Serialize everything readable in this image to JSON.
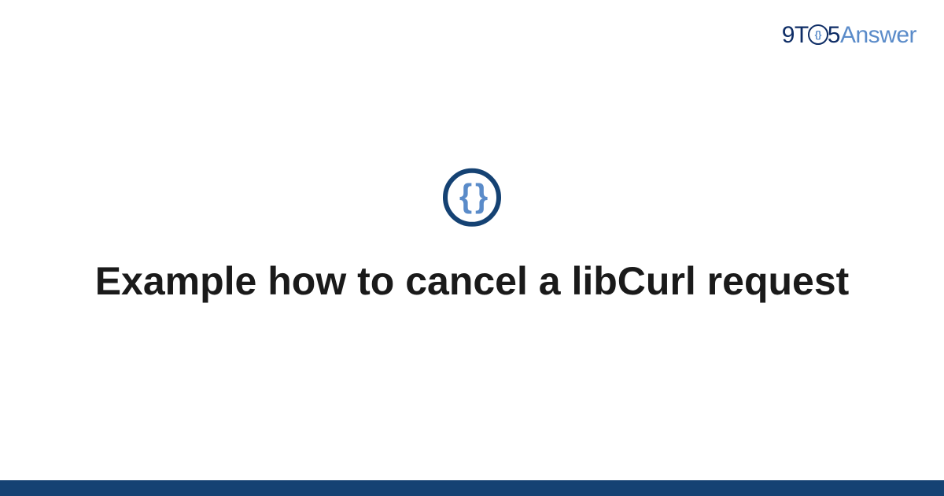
{
  "header": {
    "logo": {
      "part1": "9T",
      "part_o_inner": "{}",
      "part2": "5",
      "part3": "Answer"
    }
  },
  "main": {
    "icon_glyph": "{ }",
    "title": "Example how to cancel a libCurl request"
  },
  "colors": {
    "dark_blue": "#154273",
    "light_blue": "#5a8bc9",
    "navy": "#0e2d66"
  }
}
